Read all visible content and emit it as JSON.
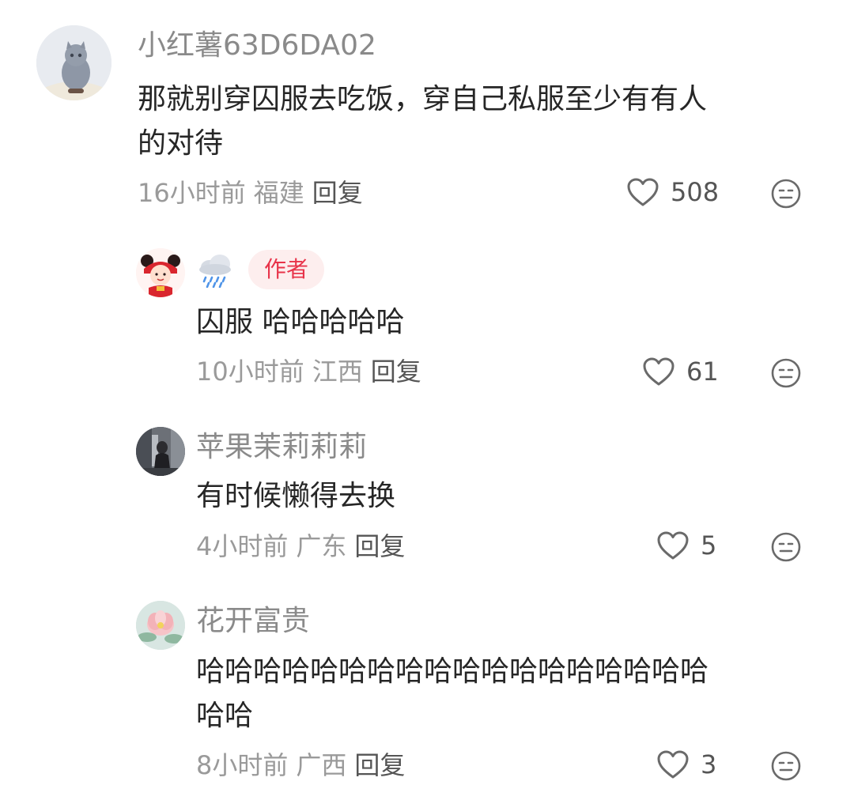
{
  "comments": [
    {
      "username": "小红薯63D6DA02",
      "content_lines": [
        "那就别穿囚服去吃饭，穿自己私服至少有有人",
        "的对待"
      ],
      "time": "16小时前",
      "location": "福建",
      "reply_label": "回复",
      "likes": "508"
    },
    {
      "username": "🌧",
      "badge": "作者",
      "content_lines": [
        "囚服 哈哈哈哈哈"
      ],
      "time": "10小时前",
      "location": "江西",
      "reply_label": "回复",
      "likes": "61"
    },
    {
      "username": "苹果茉莉莉莉",
      "content_lines": [
        "有时候懒得去换"
      ],
      "time": "4小时前",
      "location": "广东",
      "reply_label": "回复",
      "likes": "5"
    },
    {
      "username": "花开富贵",
      "content_lines": [
        "哈哈哈哈哈哈哈哈哈哈哈哈哈哈哈哈哈哈",
        "哈哈"
      ],
      "time": "8小时前",
      "location": "广西",
      "reply_label": "回复",
      "likes": "3"
    }
  ],
  "colors": {
    "badge_bg": "#fdeeee",
    "badge_text": "#e8344a",
    "meta_text": "#9a9a9a",
    "username_text": "#8a8a8a"
  },
  "icons": {
    "like": "heart-icon",
    "more": "emoji-face-icon"
  }
}
